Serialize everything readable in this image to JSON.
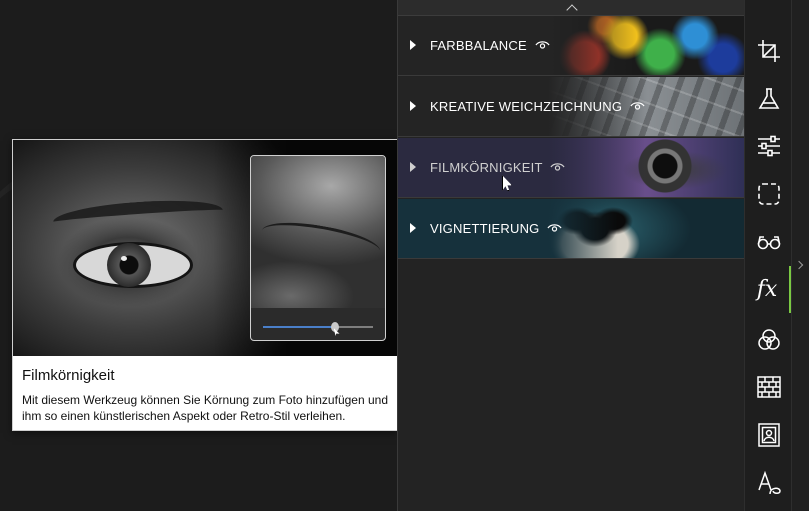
{
  "tooltip": {
    "title": "Filmkörnigkeit",
    "description": "Mit diesem Werkzeug können Sie Körnung zum Foto hinzufügen und ihm so einen künstlerischen Aspekt oder Retro-Stil verleihen.",
    "preview_slider_value": 0.65
  },
  "effects": [
    {
      "label": "FARBBALANCE",
      "visibility_icon": "eye-icon",
      "state": "normal"
    },
    {
      "label": "KREATIVE WEICHZEICHNUNG",
      "visibility_icon": "eye-icon",
      "state": "normal"
    },
    {
      "label": "FILMKÖRNIGKEIT",
      "visibility_icon": "eye-icon",
      "state": "hover"
    },
    {
      "label": "VIGNETTIERUNG",
      "visibility_icon": "eye-icon",
      "state": "normal"
    }
  ],
  "toolbar": {
    "tools": [
      "crop-icon",
      "flask-icon",
      "sliders-icon",
      "selection-icon",
      "glasses-icon",
      "fx-icon",
      "color-circles-icon",
      "texture-bricks-icon",
      "frame-icon",
      "text-icon"
    ],
    "active_tool": "fx-icon",
    "fx_label": "fx"
  },
  "colors": {
    "accent": "#7ac943",
    "panel_bg": "#232323",
    "slider_fill": "#4a7fc9"
  }
}
